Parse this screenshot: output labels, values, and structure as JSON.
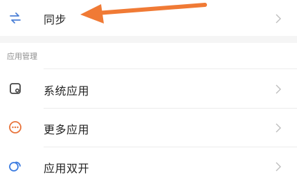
{
  "sync_row": {
    "label": "同步",
    "icon": "sync-icon"
  },
  "section": {
    "header": "应用管理"
  },
  "items": [
    {
      "label": "系统应用",
      "icon": "system-apps-icon"
    },
    {
      "label": "更多应用",
      "icon": "more-apps-icon"
    },
    {
      "label": "应用双开",
      "icon": "dual-apps-icon"
    }
  ],
  "colors": {
    "sync_icon": "#4a7fd6",
    "system_icon": "#444444",
    "more_icon": "#e8733a",
    "dual_icon": "#3b7be0",
    "annotation_arrow": "#f07a35"
  }
}
